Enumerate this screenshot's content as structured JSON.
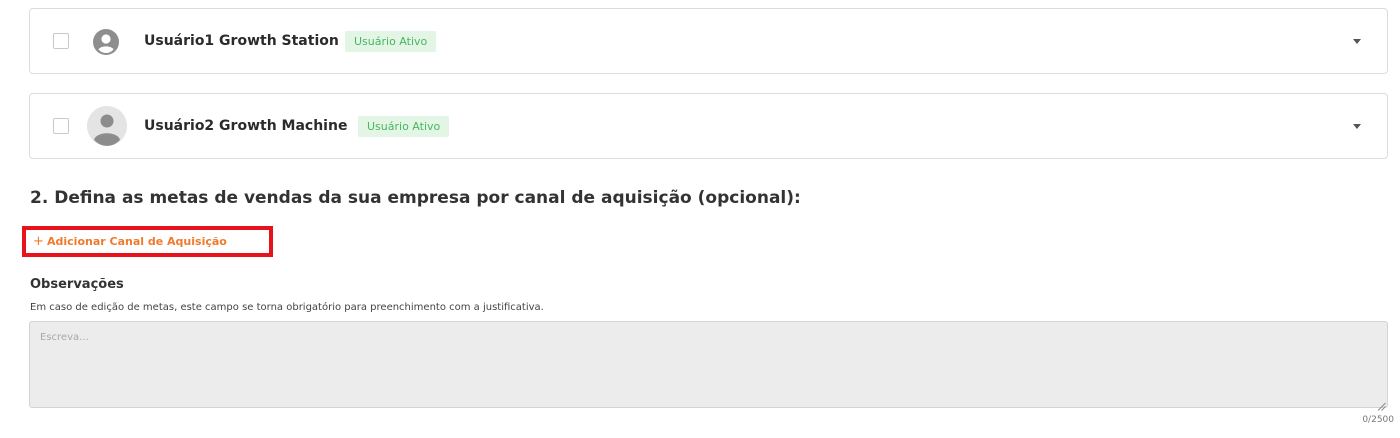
{
  "users": [
    {
      "name": "Usuário1 Growth Station",
      "status": "Usuário Ativo",
      "avatar": "user-circle-icon"
    },
    {
      "name": "Usuário2 Growth Machine",
      "status": "Usuário Ativo",
      "avatar": "photo-avatar"
    }
  ],
  "section": {
    "title": "2. Defina as metas de vendas da sua empresa por canal de aquisição (opcional):",
    "add_channel_plus": "+",
    "add_channel_label": "Adicionar Canal de Aquisição"
  },
  "observations": {
    "title": "Observações",
    "hint": "Em caso de edição de metas, este campo se torna obrigatório para preenchimento com a justificativa.",
    "placeholder": "Escreva...",
    "value": "",
    "counter": "0/2500"
  },
  "colors": {
    "accent": "#f07a2c",
    "badge_bg": "#e3f6e6",
    "badge_text": "#49b55f",
    "highlight_border": "#e8121d"
  }
}
